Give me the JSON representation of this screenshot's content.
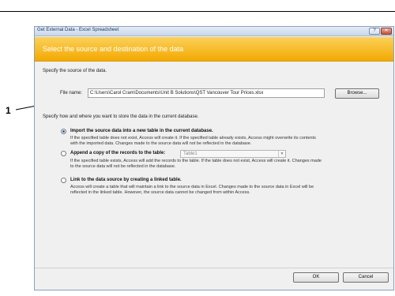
{
  "dialog": {
    "title": "Get External Data - Excel Spreadsheet",
    "title_buttons": {
      "help": "?",
      "close": "✕"
    },
    "banner": "Select the source and destination of the data"
  },
  "source": {
    "heading": "Specify the source of the data.",
    "file_label": "File name:",
    "file_value": "C:\\Users\\Carol Cram\\Documents\\Unit B Solutions\\QST Vancouver Tour Prices.xlsx",
    "browse": "Browse..."
  },
  "destination": {
    "heading": "Specify how and where you want to store the data in the current database.",
    "options": [
      {
        "label": "Import the source data into a new table in the current database.",
        "selected": true,
        "desc": [
          "If the specified table does not exist, Access will create it. If the specified table already exists, Access might overwrite its contents",
          "with the imported data. Changes made to the source data will not be reflected in the database."
        ]
      },
      {
        "label": "Append a copy of the records to the table:",
        "selected": false,
        "select_value": "Table1",
        "desc": [
          "If the specified table exists, Access will add the records to the table. If the table does not exist, Access will create it. Changes made",
          "to the source data will not be reflected in the database."
        ]
      },
      {
        "label": "Link to the data source by creating a linked table.",
        "selected": false,
        "desc": [
          "Access will create a table that will maintain a link to the source data in Excel. Changes made to the source data in Excel will be",
          "reflected in the linked table. However, the source data cannot be changed from within Access."
        ]
      }
    ]
  },
  "footer": {
    "ok": "OK",
    "cancel": "Cancel"
  },
  "callout": "1"
}
